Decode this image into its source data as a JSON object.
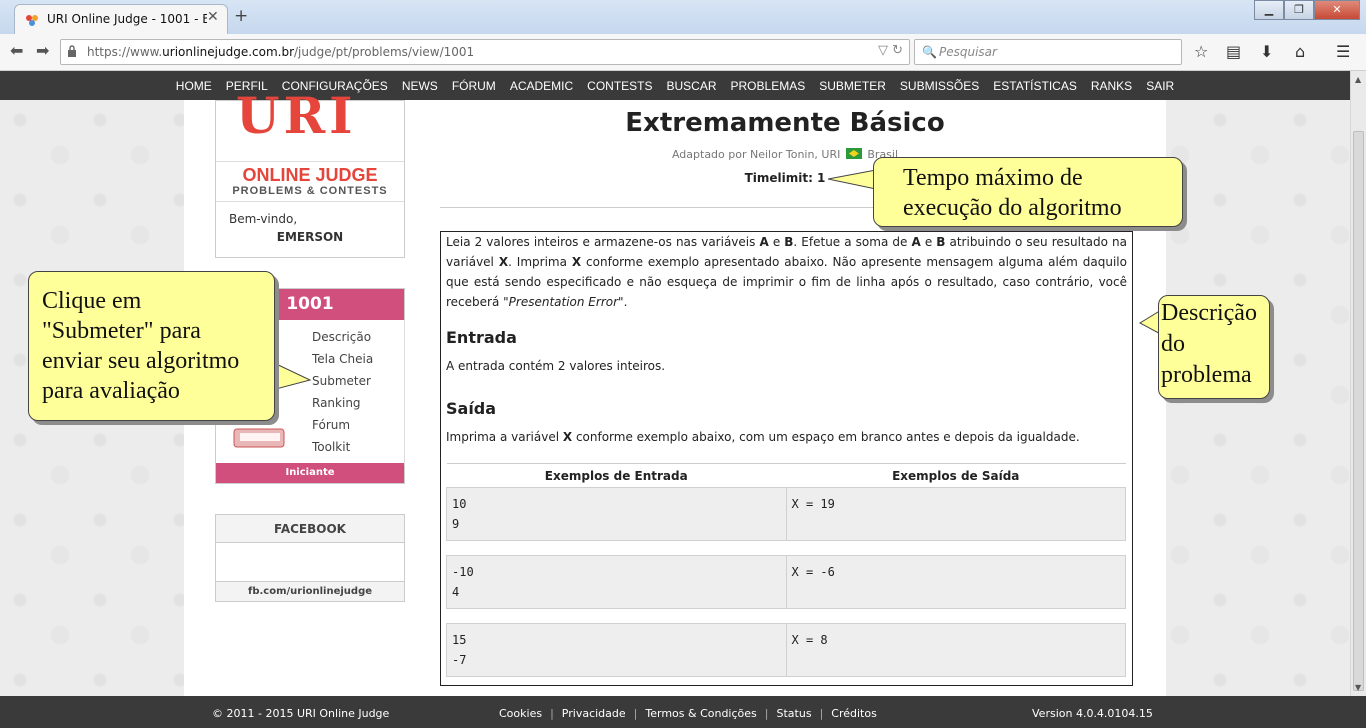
{
  "browser": {
    "tab_title": "URI Online Judge - 1001 - E...",
    "url_prefix": "https://www.",
    "url_domain": "urionlinejudge.com.br",
    "url_path": "/judge/pt/problems/view/1001",
    "search_placeholder": "Pesquisar"
  },
  "sitenav": [
    "HOME",
    "PERFIL",
    "CONFIGURAÇÕES",
    "NEWS",
    "FÓRUM",
    "ACADEMIC",
    "CONTESTS",
    "BUSCAR",
    "PROBLEMAS",
    "SUBMETER",
    "SUBMISSÕES",
    "ESTATÍSTICAS",
    "RANKS",
    "SAIR"
  ],
  "sidebar": {
    "logo_text": "URI",
    "logo_title": "ONLINE JUDGE",
    "logo_subtitle": "PROBLEMS & CONTESTS",
    "welcome": "Bem-vindo,",
    "username": "EMERSON",
    "problem_id": "1001",
    "problem_menu": [
      "Descrição",
      "Tela Cheia",
      "Submeter",
      "Ranking",
      "Fórum",
      "Toolkit"
    ],
    "problem_level": "Iniciante",
    "facebook_title": "FACEBOOK",
    "facebook_link": "fb.com/urionlinejudge"
  },
  "problem": {
    "title": "Extremamente Básico",
    "author_prefix": "Adaptado por Neilor Tonin, URI",
    "author_country": "Brasil",
    "timelimit": "Timelimit: 1",
    "desc_1": "Leia 2 valores inteiros e armazene-os nas variáveis ",
    "desc_A": "A",
    "desc_2": " e ",
    "desc_B": "B",
    "desc_3": ". Efetue a soma de ",
    "desc_4": " atribuindo o seu resultado na variável ",
    "desc_X": "X",
    "desc_5": ". Imprima ",
    "desc_6": " conforme exemplo apresentado abaixo. Não apresente mensagem alguma além daquilo que está sendo especificado e não esqueça de imprimir o fim de linha após o resultado, caso contrário, você receberá \"",
    "desc_err": "Presentation Error",
    "desc_7": "\".",
    "entrada_title": "Entrada",
    "entrada_text": "A entrada contém 2 valores inteiros.",
    "saida_title": "Saída",
    "saida_pre": "Imprima a variável ",
    "saida_post": " conforme exemplo abaixo, com um espaço em branco antes e depois da igualdade.",
    "examples_in_header": "Exemplos de Entrada",
    "examples_out_header": "Exemplos de Saída",
    "examples": [
      {
        "input": "10\n9",
        "output": "X = 19"
      },
      {
        "input": "-10\n4",
        "output": "X = -6"
      },
      {
        "input": "15\n-7",
        "output": "X = 8"
      }
    ]
  },
  "callouts": {
    "timelimit_note": "Tempo máximo de\nexecução do algoritmo",
    "submit_note": "Clique em\n\"Submeter\" para\nenviar seu algoritmo\npara avaliação",
    "description_note": "Descrição\ndo\nproblema"
  },
  "footer": {
    "copyright": "© 2011 - 2015 URI Online Judge",
    "links": [
      "Cookies",
      "Privacidade",
      "Termos & Condições",
      "Status",
      "Créditos"
    ],
    "version": "Version 4.0.4.0104.15"
  },
  "colors": {
    "accent_pink": "#d14f7d",
    "logo_red": "#e5453b",
    "callout_yellow": "#ffff99"
  }
}
